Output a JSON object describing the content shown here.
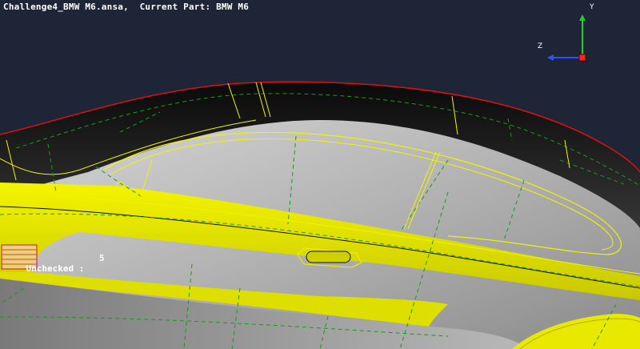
{
  "window": {
    "file_name": "Challenge4_BMW M6.ansa",
    "current_part_label": "Current Part:",
    "current_part": "BMW M6"
  },
  "status": {
    "unchecked_label": "Unchecked :",
    "unchecked_count": "5"
  },
  "axes": {
    "y_label": "Y",
    "z_label": "Z",
    "x_color": "#ff2020",
    "y_color": "#20d020",
    "z_color": "#3050ff"
  },
  "colors": {
    "background": "#1d2536",
    "surface_grey": "#a8a8a8",
    "highlight_yellow": "#e6e600",
    "feature_line": "#f2f200",
    "dashed_edge": "#1a9a1a",
    "boundary_red": "#e01010"
  }
}
